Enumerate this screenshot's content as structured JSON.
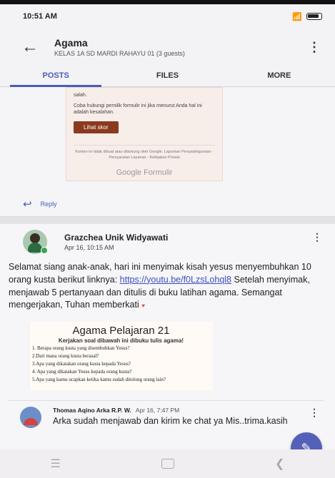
{
  "status_bar": {
    "time": "10:51 AM"
  },
  "appbar": {
    "title": "Agama",
    "subtitle": "KELAS 1A SD MARDI RAHAYU 01 (3 guests)"
  },
  "tabs": [
    {
      "label": "POSTS",
      "active": true
    },
    {
      "label": "FILES",
      "active": false
    },
    {
      "label": "MORE",
      "active": false
    }
  ],
  "form_card": {
    "top_text": "salah.",
    "message": "Coba hubungi pemilik formulir ini jika menurut Anda hal ini adalah kesalahan.",
    "button": "Lihat skor",
    "footer": "Konten ini tidak dibuat atau didukung oleh Google. Laporkan Penyalahgunaan - Persyaratan Layanan - Kebijakan Privasi",
    "brand": "Google Formulir"
  },
  "reply_label": "Reply",
  "post": {
    "author": "Grazchea Unik Widyawati",
    "date": "Apr 16, 10:15 AM",
    "text_before_link": "Selamat siang anak-anak, hari ini menyimak kisah yesus menyembuhkan 10 orang kusta berikut linknya: ",
    "link": "https://youtu.be/f0LzsLohql8",
    "text_after_link": " Setelah menyimak, menjawab 5 pertanyaan dan ditulis di buku latihan agama. Semangat mengerjakan, Tuhan memberkati ",
    "worksheet": {
      "title": "Agama Pelajaran 21",
      "instruction": "Kerjakan soal dibawah ini dibuku tulis agama!",
      "questions": [
        "1. Berapa orang kusta yang disembuhkan Yesus?",
        "2.Dari mana orang kusta berasal?",
        "3.Apa yang dikatakan orang kusta kepada Yesus?",
        "4. Apa yang dikatakan Yesus kepada orang kusta?",
        "5.Apa yang kamu ucapkan ketika kamu sudah ditolong orang lain?"
      ]
    }
  },
  "reply": {
    "author": "Thomas Aqino Arka R.P. W.",
    "date": "Apr 16, 7:47 PM",
    "text": "Arka sudah menjawab dan kirim ke chat ya Mis..trima.kasih"
  },
  "colors": {
    "accent": "#4a5bb8",
    "fab": "#5561b8",
    "button": "#8b3a1e"
  }
}
